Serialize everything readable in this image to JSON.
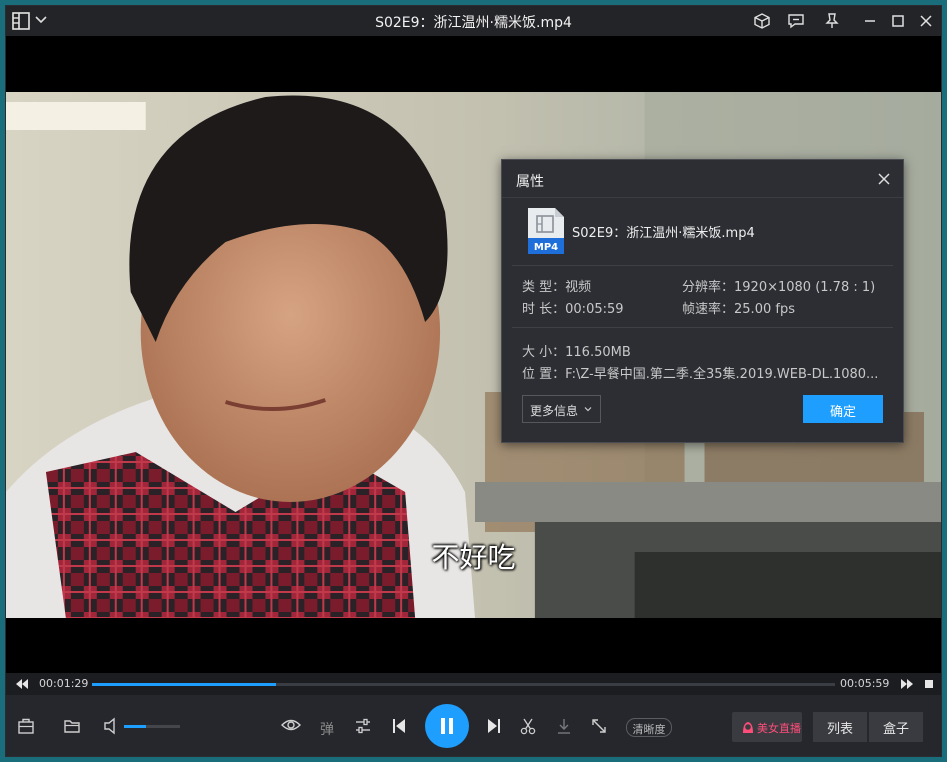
{
  "window": {
    "title": "S02E9：浙江温州·糯米饭.mp4",
    "buttons": [
      "cube-icon",
      "comment-icon",
      "pin-icon",
      "minimize-icon",
      "maximize-icon",
      "close-icon"
    ]
  },
  "video": {
    "subtitle": "不好吃"
  },
  "dialog": {
    "title": "属性",
    "file_badge": "MP4",
    "file_name": "S02E9：浙江温州·糯米饭.mp4",
    "type_label": "类 型：",
    "type_value": "视频",
    "resolution_label": "分辨率：",
    "resolution_value": "1920×1080 (1.78 : 1)",
    "duration_label": "时 长：",
    "duration_value": "00:05:59",
    "framerate_label": "帧速率：",
    "framerate_value": "25.00 fps",
    "size_label": "大 小：",
    "size_value": "116.50MB",
    "location_label": "位 置：",
    "location_value": "F:\\Z-早餐中国.第二季.全35集.2019.WEB-DL.1080...",
    "more_label": "更多信息",
    "ok_label": "确定"
  },
  "playback": {
    "current_time": "00:01:29",
    "total_time": "00:05:59",
    "progress_fraction": 0.248,
    "volume_fraction": 0.4
  },
  "controls": {
    "danmu_label": "弹",
    "clarity_label": "清晰度",
    "live_label": "美女直播",
    "list_label": "列表",
    "box_label": "盒子"
  },
  "colors": {
    "accent": "#1e9fff",
    "live_pink": "#ff4d7a"
  }
}
